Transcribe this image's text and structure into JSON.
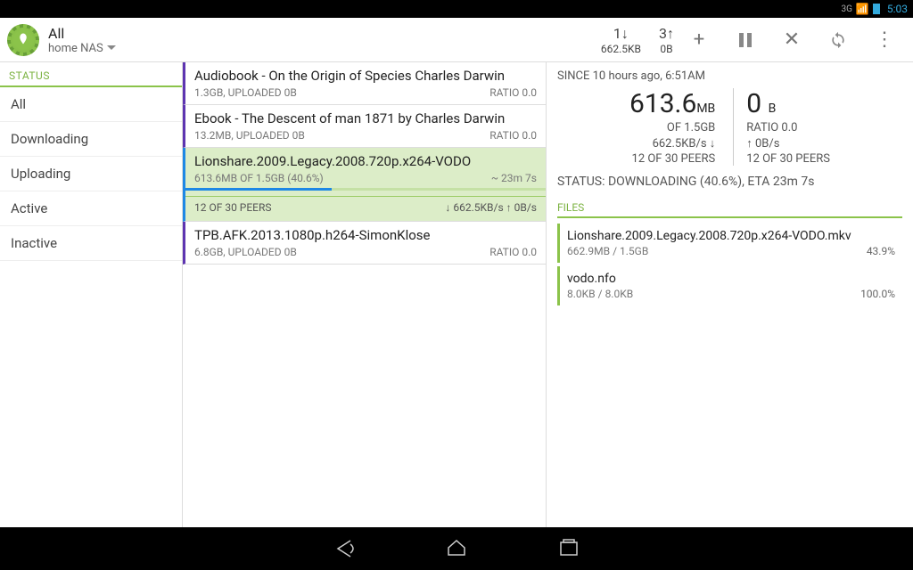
{
  "statusbar": {
    "net": "3G",
    "time": "5:03"
  },
  "actionbar": {
    "title": "All",
    "subtitle": "home NAS",
    "stats": {
      "down_count": "1↓",
      "down_rate": "662.5KB",
      "up_count": "3↑",
      "up_rate": "0B"
    }
  },
  "sidebar": {
    "header": "STATUS",
    "items": [
      "All",
      "Downloading",
      "Uploading",
      "Active",
      "Inactive"
    ]
  },
  "torrents": [
    {
      "title": "Audiobook - On the Origin of Species  Charles Darwin",
      "sub": "1.3GB, UPLOADED 0B",
      "ratio": "RATIO 0.0",
      "color": "#5e35b1",
      "selected": false
    },
    {
      "title": "Ebook - The Descent of man 1871 by Charles Darwin",
      "sub": "13.2MB, UPLOADED 0B",
      "ratio": "RATIO 0.0",
      "color": "#5e35b1",
      "selected": false
    },
    {
      "title": "Lionshare.2009.Legacy.2008.720p.x264-VODO",
      "sub": "613.6MB OF 1.5GB (40.6%)",
      "ratio": "~ 23m 7s",
      "color": "#1e88e5",
      "selected": true,
      "progress": 40.6,
      "peers_left": "12 OF 30 PEERS",
      "peers_right": "↓ 662.5KB/s ↑ 0B/s"
    },
    {
      "title": "TPB.AFK.2013.1080p.h264-SimonKlose",
      "sub": "6.8GB, UPLOADED 0B",
      "ratio": "RATIO 0.0",
      "color": "#5e35b1",
      "selected": false
    }
  ],
  "details": {
    "since": "SINCE 10 hours ago, 6:51AM",
    "dl_val": "613.6",
    "dl_unit": "MB",
    "dl_of": "OF 1.5GB",
    "dl_rate": "662.5KB/s ↓",
    "dl_peers": "12 OF 30 PEERS",
    "ul_val": "0",
    "ul_unit": "B",
    "ul_ratio": "RATIO 0.0",
    "ul_rate": "↑ 0B/s",
    "ul_peers": "12 OF 30 PEERS",
    "status": "STATUS: DOWNLOADING (40.6%), ETA 23m 7s",
    "files_header": "FILES",
    "files": [
      {
        "name": "Lionshare.2009.Legacy.2008.720p.x264-VODO.mkv",
        "size": "662.9MB / 1.5GB",
        "pct": "43.9%"
      },
      {
        "name": "vodo.nfo",
        "size": "8.0KB / 8.0KB",
        "pct": "100.0%"
      }
    ]
  }
}
